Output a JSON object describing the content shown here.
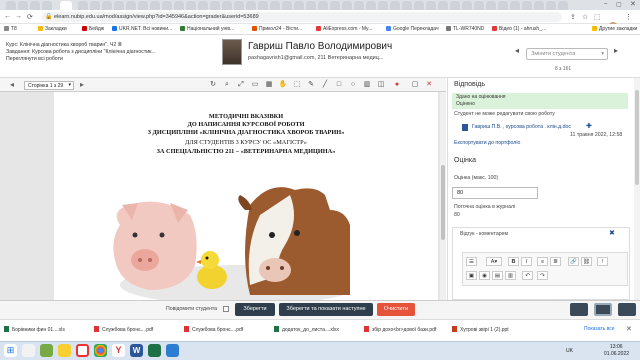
{
  "browser": {
    "url": "elearn.nubip.edu.ua/mod/assign/view.php?id=345946&action=grader&userid=53689",
    "bookmarks": [
      "Т8",
      "Закладки",
      "Бейдж",
      "UKR.NET: Всі новини...",
      "Національний унів...",
      "Прикол24 - Вісти...",
      "AliExpress.com - My...",
      "Google Перекладач",
      "TL-WR740ND",
      "Відео (1) - ahrush_...",
      "Другие закладки"
    ],
    "page_title": "Курсова"
  },
  "header": {
    "course_label": "Курс: Клінічна діагностика хвороб тварин\". Ч2 ≣",
    "assignment_label": "Завдання: Курсова робота з дисципліни \"Клінічна діагностик...",
    "view_all_link": "Переглянути всі роботи",
    "student_name": "Гавриш Павло Володимирович",
    "student_info": "pashagavrish1@gmail.com, 211 Ветеринарна медиц...",
    "student_select_placeholder": "Змінити студента",
    "counter": "8 з 161"
  },
  "pdf": {
    "page_select": "Сторінка 1 з 29",
    "doc_lines": [
      "МЕТОДИЧНІ ВКАЗІВКИ",
      "ДО НАПИСАННЯ КУРСОВОЇ РОБОТИ",
      "З ДИСЦИПЛІНИ «КЛІНІЧНА ДІАГНОСТИКА ХВОРОБ ТВАРИН»",
      "ДЛЯ СТУДЕНТІВ 3 КУРСУ ОС «МАГІСТР»",
      "ЗА СПЕЦІАЛЬНІСТЮ 211 – «ВЕТЕРИНАРНА МЕДИЦИНА»"
    ]
  },
  "right": {
    "response_title": "Відповідь",
    "status_submitted": "Здано на оцінювання",
    "status_graded": "Оцінено",
    "cannot_edit": "Студент не може редагувати свою роботу",
    "file_name": "Гавриш П.В. , курсова робота . клін.д.doc",
    "file_date": "11 травня 2022, 12:58",
    "export_link": "Експортувати до портфоліо",
    "grade_title": "Оцінка",
    "grade_label": "Оцінка (макс. 100)",
    "grade_value": "80",
    "current_grade_label": "Поточна оцінка в журналі",
    "current_grade_value": "80",
    "feedback_title": "Відгук - коментарем"
  },
  "bottom": {
    "notify_label": "Повідомити студента",
    "save_label": "Зберегти",
    "save_next_label": "Зберегти та показати наступне",
    "reset_label": "Очистити"
  },
  "downloads": {
    "files": [
      "Борівники фин 01....xls",
      "Службова бронє....pdf",
      "Службова бронє....pdf",
      "додаток_до_листа....xlsx",
      "збір дохо<br>дової бази.pdf",
      "Хутрові звірі 1 (2).ppt"
    ],
    "show_all": "Показать все"
  },
  "taskbar": {
    "lang": "UK",
    "time": "13:06",
    "date": "01.06.2022"
  },
  "colors": {
    "save": "#2f3e4c",
    "save_next": "#2f3e4c",
    "reset": "#e5533a",
    "status_bg": "#d9f2d9"
  }
}
